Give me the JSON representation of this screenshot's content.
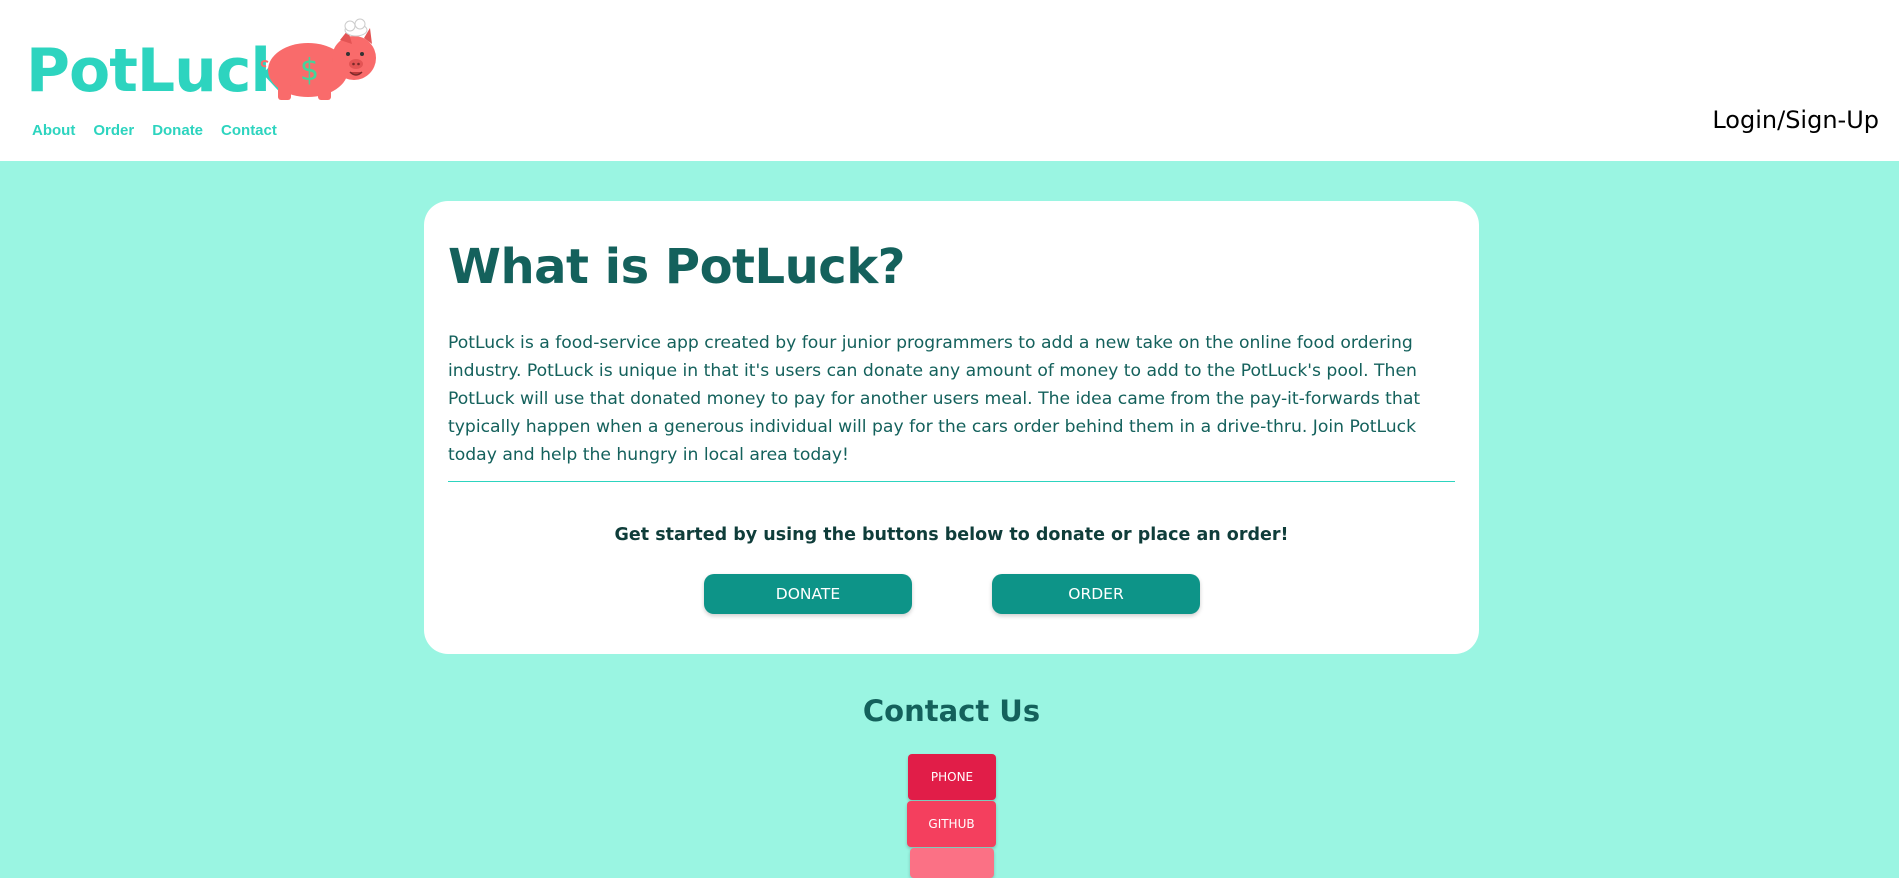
{
  "header": {
    "brand": "PotLuck",
    "logo_icon": "pig-chef-piggy-bank-icon",
    "nav": [
      {
        "label": "About"
      },
      {
        "label": "Order"
      },
      {
        "label": "Donate"
      },
      {
        "label": "Contact"
      }
    ],
    "login_label": "Login/Sign-Up"
  },
  "main": {
    "title": "What is PotLuck?",
    "description": "PotLuck is a food-service app created by four junior programmers to add a new take on the online food ordering industry. PotLuck is unique in that it's users can donate any amount of money to add to the PotLuck's pool. Then PotLuck will use that donated money to pay for another users meal. The idea came from the pay-it-forwards that typically happen when a generous individual will pay for the cars order behind them in a drive-thru. Join PotLuck today and help the hungry in local area today!",
    "cta_text": "Get started by using the buttons below to donate or place an order!",
    "donate_label": "DONATE",
    "order_label": "ORDER"
  },
  "contact": {
    "title": "Contact Us",
    "buttons": [
      {
        "label": "PHONE"
      },
      {
        "label": "GITHUB"
      },
      {
        "label": ""
      }
    ]
  },
  "colors": {
    "brand": "#2dd4bf",
    "page_background": "#9af5e2",
    "heading": "#14615c",
    "primary_button": "#0d9488",
    "phone_button": "#e11d48",
    "github_button": "#f43f5e",
    "third_button": "#fb7185",
    "pig": "#f96b6b"
  }
}
